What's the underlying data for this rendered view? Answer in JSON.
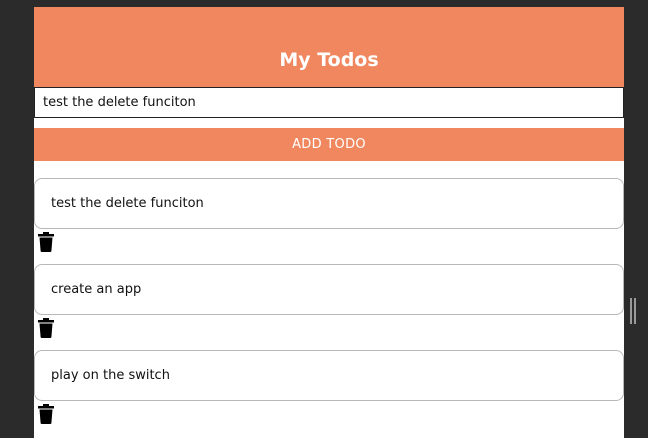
{
  "header": {
    "title": "My Todos"
  },
  "new_todo": {
    "value": "test the delete funciton",
    "button_label": "ADD TODO"
  },
  "todos": [
    {
      "text": "test the delete funciton",
      "delete_icon": "trash-icon"
    },
    {
      "text": "create an app",
      "delete_icon": "trash-icon"
    },
    {
      "text": "play on the switch",
      "delete_icon": "trash-icon"
    }
  ],
  "colors": {
    "accent": "#f0875e",
    "background": "#2b2b2b"
  }
}
